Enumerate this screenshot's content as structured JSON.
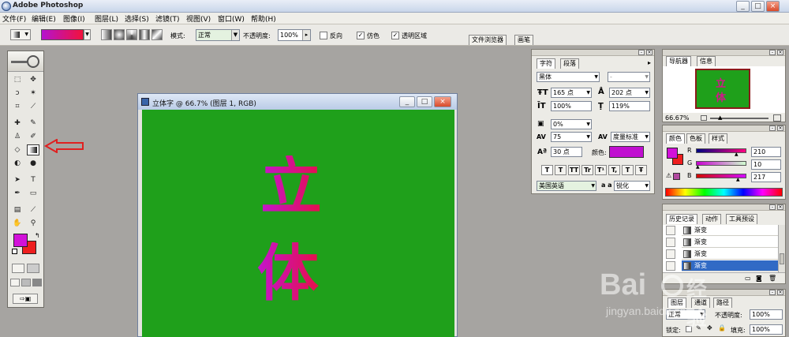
{
  "app": {
    "title": "Adobe Photoshop"
  },
  "window_buttons": [
    "_",
    "□",
    "×"
  ],
  "menu": [
    "文件(F)",
    "编辑(E)",
    "图像(I)",
    "图层(L)",
    "选择(S)",
    "滤镜(T)",
    "视图(V)",
    "窗口(W)",
    "帮助(H)"
  ],
  "options": {
    "mode_label": "模式:",
    "mode_value": "正常",
    "opacity_label": "不透明度:",
    "opacity_value": "100%",
    "reverse_label": "反向",
    "dither_label": "仿色",
    "transparency_label": "透明区域",
    "file_browser_tab": "文件浏览器",
    "brushes_tab": "画笔",
    "gradient_start": "#b413d0",
    "gradient_end": "#f2123c"
  },
  "colors": {
    "foreground": "#d211d9",
    "background": "#ee1e1e",
    "canvas": "#1fa01b",
    "arrow": "#e02020"
  },
  "document": {
    "title": "立体字 @ 66.7% (图层 1, RGB)",
    "chars": [
      "立",
      "体"
    ]
  },
  "character_panel": {
    "tabs": [
      "字符",
      "段落"
    ],
    "font_family": "黑体",
    "font_style": "-",
    "font_size": "165 点",
    "leading": "202 点",
    "vertical_scale": "100%",
    "horizontal_scale": "119%",
    "tracking_pct": "0%",
    "kerning_value": "75",
    "kerning_mode": "度量标准",
    "baseline_shift": "30 点",
    "color_label": "颜色:",
    "color": "#c00fd0",
    "style_buttons": [
      "T",
      "T",
      "TT",
      "Tr",
      "T¹",
      "T,",
      "T",
      "Ŧ"
    ],
    "language": "美国英语",
    "aa_icon": "a a",
    "antialias": "锐化"
  },
  "navigator": {
    "tabs": [
      "导航器",
      "信息"
    ],
    "zoom": "66.67%",
    "thumb_chars": [
      "立",
      "体"
    ]
  },
  "color_panel": {
    "tabs": [
      "颜色",
      "色板",
      "样式"
    ],
    "channels": [
      {
        "label": "R",
        "value": "210",
        "level": 0.82
      },
      {
        "label": "G",
        "value": "10",
        "level": 0.04
      },
      {
        "label": "B",
        "value": "217",
        "level": 0.85
      }
    ]
  },
  "history_panel": {
    "tabs": [
      "历史记录",
      "动作",
      "工具预设"
    ],
    "items": [
      "渐变",
      "渐变",
      "渐变",
      "渐变"
    ]
  },
  "layers_panel": {
    "tabs": [
      "图层",
      "通道",
      "路径"
    ],
    "mode": "正常",
    "opacity_label": "不透明度:",
    "opacity": "100%",
    "lock_label": "锁定:",
    "fill_label": "填充:",
    "fill": "100%"
  },
  "watermark": {
    "brand": "Bai",
    "brand2": "经验",
    "url": "jingyan.baidu.com"
  }
}
